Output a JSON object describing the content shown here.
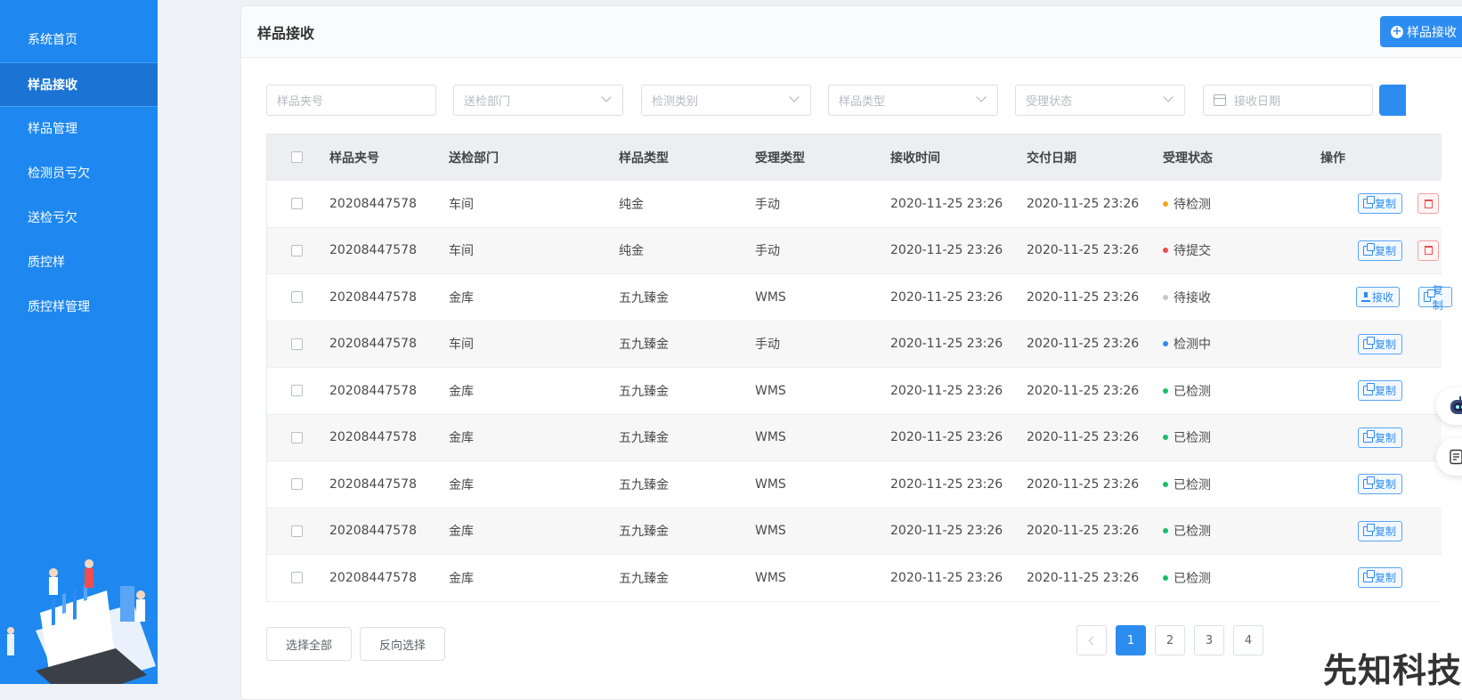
{
  "sidebar": {
    "items": [
      {
        "label": "系统首页",
        "active": false
      },
      {
        "label": "样品接收",
        "active": true
      },
      {
        "label": "样品管理",
        "active": false
      },
      {
        "label": "检测员亏欠",
        "active": false
      },
      {
        "label": "送检亏欠",
        "active": false
      },
      {
        "label": "质控样",
        "active": false
      },
      {
        "label": "质控样管理",
        "active": false
      }
    ]
  },
  "card": {
    "title": "样品接收",
    "header_button": "样品接收"
  },
  "filters": {
    "sample_no": "样品夹号",
    "department": "送检部门",
    "test_category": "检测类别",
    "sample_type": "样品类型",
    "status": "受理状态",
    "receive_date": "接收日期"
  },
  "table": {
    "headers": [
      "样品夹号",
      "送检部门",
      "样品类型",
      "受理类型",
      "接收时间",
      "交付日期",
      "受理状态",
      "操作"
    ],
    "rows": [
      {
        "no": "20208447578",
        "dept": "车间",
        "type": "纯金",
        "accept": "手动",
        "recv": "2020-11-25 23:26",
        "deliver": "2020-11-25 23:26",
        "status": "待检测",
        "status_color": "#f5a623",
        "actions": [
          "复制",
          "删除"
        ]
      },
      {
        "no": "20208447578",
        "dept": "车间",
        "type": "纯金",
        "accept": "手动",
        "recv": "2020-11-25 23:26",
        "deliver": "2020-11-25 23:26",
        "status": "待提交",
        "status_color": "#f04d4d",
        "actions": [
          "复制",
          "删除"
        ]
      },
      {
        "no": "20208447578",
        "dept": "金库",
        "type": "五九臻金",
        "accept": "WMS",
        "recv": "2020-11-25 23:26",
        "deliver": "2020-11-25 23:26",
        "status": "待接收",
        "status_color": "#c8c8c8",
        "actions": [
          "接收",
          "复制"
        ]
      },
      {
        "no": "20208447578",
        "dept": "车间",
        "type": "五九臻金",
        "accept": "手动",
        "recv": "2020-11-25 23:26",
        "deliver": "2020-11-25 23:26",
        "status": "检测中",
        "status_color": "#2d8cf0",
        "actions": [
          "复制"
        ]
      },
      {
        "no": "20208447578",
        "dept": "金库",
        "type": "五九臻金",
        "accept": "WMS",
        "recv": "2020-11-25 23:26",
        "deliver": "2020-11-25 23:26",
        "status": "已检测",
        "status_color": "#19be6b",
        "actions": [
          "复制"
        ]
      },
      {
        "no": "20208447578",
        "dept": "金库",
        "type": "五九臻金",
        "accept": "WMS",
        "recv": "2020-11-25 23:26",
        "deliver": "2020-11-25 23:26",
        "status": "已检测",
        "status_color": "#19be6b",
        "actions": [
          "复制"
        ]
      },
      {
        "no": "20208447578",
        "dept": "金库",
        "type": "五九臻金",
        "accept": "WMS",
        "recv": "2020-11-25 23:26",
        "deliver": "2020-11-25 23:26",
        "status": "已检测",
        "status_color": "#19be6b",
        "actions": [
          "复制"
        ]
      },
      {
        "no": "20208447578",
        "dept": "金库",
        "type": "五九臻金",
        "accept": "WMS",
        "recv": "2020-11-25 23:26",
        "deliver": "2020-11-25 23:26",
        "status": "已检测",
        "status_color": "#19be6b",
        "actions": [
          "复制"
        ]
      },
      {
        "no": "20208447578",
        "dept": "金库",
        "type": "五九臻金",
        "accept": "WMS",
        "recv": "2020-11-25 23:26",
        "deliver": "2020-11-25 23:26",
        "status": "已检测",
        "status_color": "#19be6b",
        "actions": [
          "复制"
        ]
      }
    ]
  },
  "footer": {
    "select_all": "选择全部",
    "invert": "反向选择",
    "pages": [
      "1",
      "2",
      "3",
      "4"
    ],
    "current_page": "1"
  },
  "watermark": "先知科技",
  "colors": {
    "accent": "#2d8cf0",
    "sidebar": "#1e88f0",
    "sidebar_active": "#1b74d4"
  }
}
